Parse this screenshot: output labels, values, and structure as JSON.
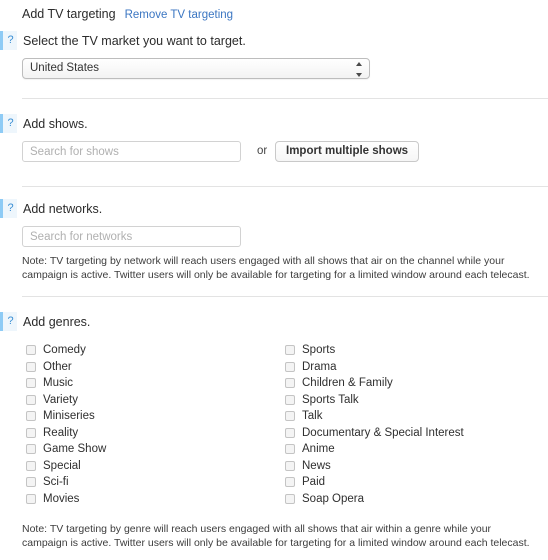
{
  "header": {
    "title": "Add TV targeting",
    "remove_link": "Remove TV targeting"
  },
  "help_icon": "?",
  "sections": {
    "market": {
      "label": "Select the TV market you want to target.",
      "select_value": "United States",
      "select_options": [
        "United States"
      ]
    },
    "shows": {
      "label": "Add shows.",
      "search_placeholder": "Search for shows",
      "search_value": "",
      "or_text": "or",
      "import_button": "Import multiple shows"
    },
    "networks": {
      "label": "Add networks.",
      "search_placeholder": "Search for networks",
      "search_value": "",
      "note": "Note: TV targeting by network will reach users engaged with all shows that air on the channel while your campaign is active. Twitter users will only be available for targeting for a limited window around each telecast."
    },
    "genres": {
      "label": "Add genres.",
      "note": "Note: TV targeting by genre will reach users engaged with all shows that air within a genre while your campaign is active. Twitter users will only be available for targeting for a limited window around each telecast.",
      "items": [
        {
          "label": "Comedy",
          "checked": false
        },
        {
          "label": "Sports",
          "checked": false
        },
        {
          "label": "Other",
          "checked": false
        },
        {
          "label": "Drama",
          "checked": false
        },
        {
          "label": "Music",
          "checked": false
        },
        {
          "label": "Children & Family",
          "checked": false
        },
        {
          "label": "Variety",
          "checked": false
        },
        {
          "label": "Sports Talk",
          "checked": false
        },
        {
          "label": "Miniseries",
          "checked": false
        },
        {
          "label": "Talk",
          "checked": false
        },
        {
          "label": "Reality",
          "checked": false
        },
        {
          "label": "Documentary & Special Interest",
          "checked": false
        },
        {
          "label": "Game Show",
          "checked": false
        },
        {
          "label": "Anime",
          "checked": false
        },
        {
          "label": "Special",
          "checked": false
        },
        {
          "label": "News",
          "checked": false
        },
        {
          "label": "Sci-fi",
          "checked": false
        },
        {
          "label": "Paid",
          "checked": false
        },
        {
          "label": "Movies",
          "checked": false
        },
        {
          "label": "Soap Opera",
          "checked": false
        }
      ]
    }
  },
  "colors": {
    "link": "#3b76c2",
    "help_accent": "#8ecbf5",
    "help_bg": "#eef6fc",
    "divider": "#e3e3e3"
  }
}
